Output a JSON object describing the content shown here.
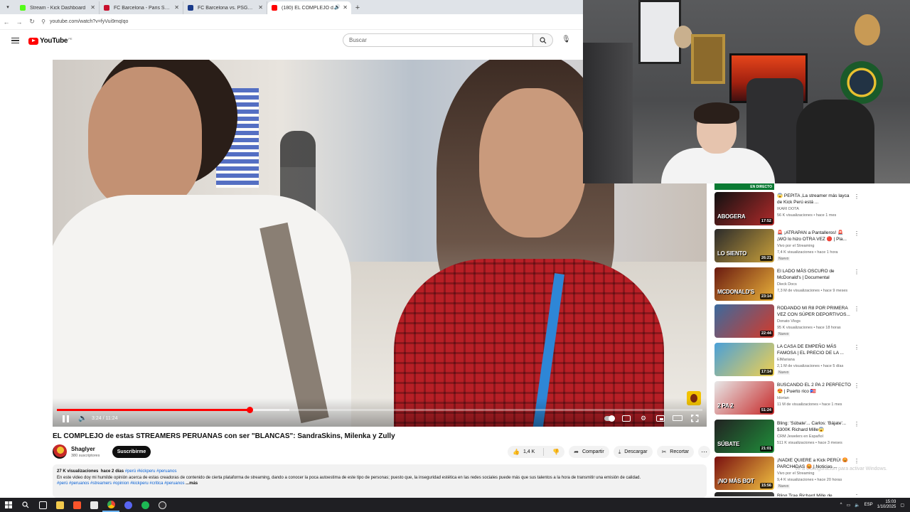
{
  "browser": {
    "tabs": [
      {
        "label": "Stream - Kick Dashboard",
        "color": "#53fc18",
        "active": false
      },
      {
        "label": "FC Barcelona - Paris Saint-Germ",
        "color": "#c8102e",
        "active": false
      },
      {
        "label": "FC Barcelona vs. PSG | Disney+",
        "color": "#1a3a8a",
        "active": false
      },
      {
        "label": "(180) EL COMPLEJO de esta",
        "color": "#ff0000",
        "active": true
      }
    ],
    "url": "youtube.com/watch?v=fyVui9mqIqo"
  },
  "youtube": {
    "logo_text": "YouTube",
    "country_code": "PE",
    "search_placeholder": "Buscar"
  },
  "player": {
    "time_current": "3:24",
    "time_total": "11:24",
    "progress_fraction": 0.298,
    "buffer_fraction": 0.36
  },
  "video": {
    "title": "EL COMPLEJO de estas STREAMERS PERUANAS con ser \"BLANCAS\": SandraSkins, Milenka y Zully",
    "channel": "Shaglyer",
    "subscribers": "380 suscriptores",
    "subscribe_label": "Suscribirme",
    "likes": "1,4 K",
    "share_label": "Compartir",
    "download_label": "Descargar",
    "clip_label": "Recortar",
    "views": "27 K visualizaciones",
    "date": "hace 2 días",
    "header_tags": "#perú #kickperu #peruanos",
    "description": "En este video doy mi humilde opinión acerca de estas creadoras de contenido de cierta plataforma de streaming, dando a conocer la poca autoestima de este tipo de personas; puesto que, la inseguridad estética en las redes sociales puede más que sus talentos a la hora de transmitir una emisión de calidad.",
    "footer_tags": "#perú #peruanos #streamers #opinion #kickperu #critica #peruanos",
    "more_label": "...más"
  },
  "sidebar": {
    "live_label": "EN DIRECTO",
    "items": [
      {
        "title": "😱 PEPITA ,La streamer más layca de Kick Perú está ...",
        "channel": "IKARI DOTA",
        "meta": "56 K visualizaciones • hace 1 mes",
        "duration": "17:52",
        "thumb_text": "ABOGERA",
        "color1": "#111111",
        "color2": "#b12a2a",
        "new": ""
      },
      {
        "title": "🚨 ¡ATRAPAN a Pantalleros! 🚨 ¡WO lo hizo OTRA VEZ 🔴 | Pla...",
        "channel": "Vivo por el Streaming",
        "meta": "7,4 K visualizaciones • hace 1 hora",
        "duration": "26:21",
        "thumb_text": "LO SIENTO",
        "color1": "#2b2b2b",
        "color2": "#c9a03a",
        "new": "Nuevo"
      },
      {
        "title": "El LADO MÁS OSCURO de McDonald's | Documental",
        "channel": "Dieck Docs",
        "meta": "7,3 M de visualizaciones • hace 9 meses",
        "duration": "23:14",
        "thumb_text": "MCDONALD'S",
        "color1": "#6a1a10",
        "color2": "#e8b13a",
        "new": ""
      },
      {
        "title": "RODANDO MI R8 POR PRIMERA VEZ CON SÚPER DEPORTIVOS...",
        "channel": "Donato Vlogs",
        "meta": "95 K visualizaciones • hace 18 horas",
        "duration": "22:44",
        "thumb_text": "",
        "color1": "#3b6a9e",
        "color2": "#d43a2a",
        "new": "Nuevo"
      },
      {
        "title": "LA CASA DE EMPEÑO MÁS FAMOSA | EL PRECIO DE LA ...",
        "channel": "ElMariana",
        "meta": "2,1 M de visualizaciones • hace 5 días",
        "duration": "17:14",
        "thumb_text": "",
        "color1": "#4aa0d8",
        "color2": "#f0d050",
        "new": "Nuevo"
      },
      {
        "title": "BUSCANDO EL 2 PA 2 PERFECTO 😍 | Puerto rico 🇵🇷",
        "channel": "Idorian",
        "meta": "11 M de visualizaciones • hace 1 mes",
        "duration": "51:24",
        "thumb_text": "2 PA 2",
        "color1": "#e8e8e8",
        "color2": "#c62828",
        "new": ""
      },
      {
        "title": "Bling: 'Súbate'... Carlos: 'Bájate'... $300K Richard Mille😱",
        "channel": "CRM Jewelers en Español",
        "meta": "511 K visualizaciones • hace 3 meses",
        "duration": "21:01",
        "thumb_text": "SÚBATE",
        "color1": "#222222",
        "color2": "#1f8f3a",
        "new": ""
      },
      {
        "title": "¡NADIE QUIERE a Kick PERÚ! 😡 PARCH4DAS 😡 | Noticias ...",
        "channel": "Vivo por el Streaming",
        "meta": "9,4 K visualizaciones • hace 20 horas",
        "duration": "15:56",
        "thumb_text": "¡NO MÁS BOT",
        "color1": "#7a1010",
        "color2": "#f0c040",
        "new": "Nuevo"
      },
      {
        "title": "Bling Trae Richard Mille de ...",
        "channel": "",
        "meta": "",
        "duration": "",
        "thumb_text": "",
        "color1": "#222222",
        "color2": "#555555",
        "new": ""
      }
    ]
  },
  "windows": {
    "watermark": "Ve a Configuración para activar Windows.",
    "lang": "ESP",
    "time": "15:03",
    "date": "1/10/2025"
  }
}
